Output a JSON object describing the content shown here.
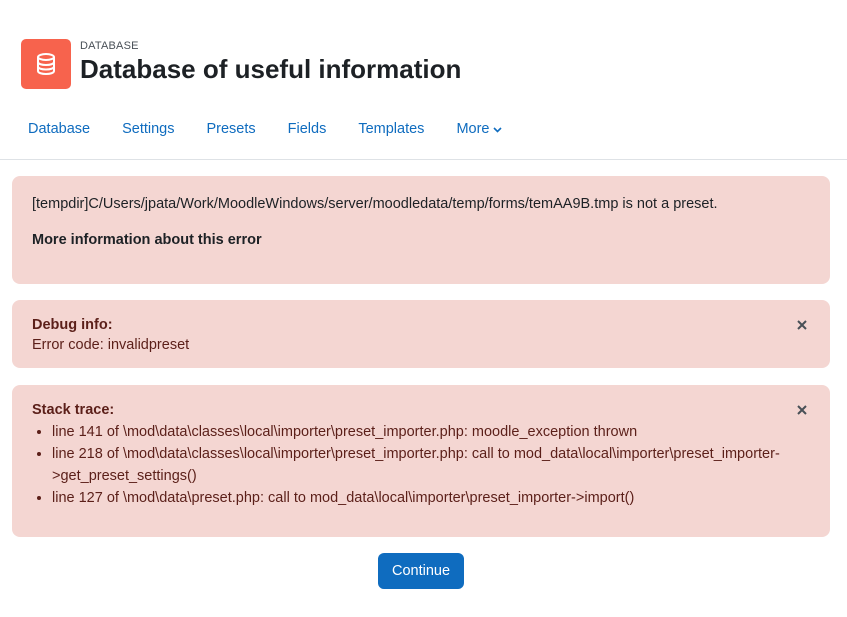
{
  "header": {
    "kicker": "DATABASE",
    "title": "Database of useful information",
    "icon": "database-icon"
  },
  "nav": {
    "tabs": [
      {
        "label": "Database"
      },
      {
        "label": "Settings"
      },
      {
        "label": "Presets"
      },
      {
        "label": "Fields"
      },
      {
        "label": "Templates"
      },
      {
        "label": "More"
      }
    ]
  },
  "error": {
    "message": "[tempdir]C/Users/jpata/Work/MoodleWindows/server/moodledata/temp/forms/temAA9B.tmp is not a preset.",
    "more_info_label": "More information about this error"
  },
  "debug": {
    "title": "Debug info:",
    "text": "Error code: invalidpreset"
  },
  "stack": {
    "title": "Stack trace:",
    "lines": [
      "line 141 of \\mod\\data\\classes\\local\\importer\\preset_importer.php: moodle_exception thrown",
      "line 218 of \\mod\\data\\classes\\local\\importer\\preset_importer.php: call to mod_data\\local\\importer\\preset_importer->get_preset_settings()",
      "line 127 of \\mod\\data\\preset.php: call to mod_data\\local\\importer\\preset_importer->import()"
    ]
  },
  "actions": {
    "continue_label": "Continue"
  },
  "colors": {
    "brand": "#0f6cbf",
    "icon_bg": "#f7634d",
    "alert_bg": "#f4d6d2"
  }
}
